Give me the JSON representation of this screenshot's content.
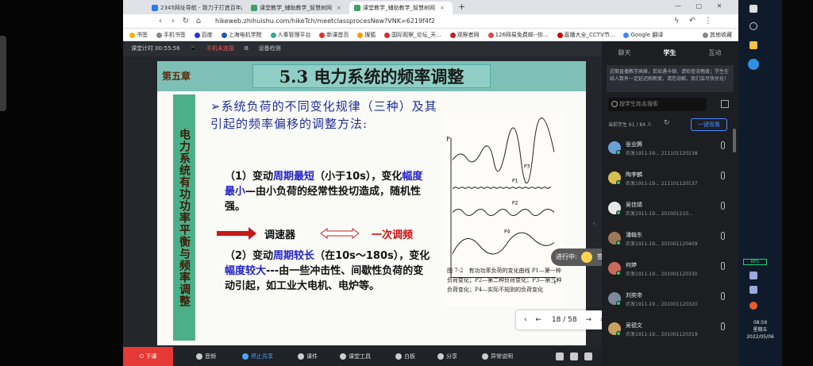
{
  "browser": {
    "tabs": [
      {
        "label": "2345网址导航 - 致力于打造百年品牌",
        "active": false
      },
      {
        "label": "课堂教学_辅助教学_智慧树网",
        "active": false
      },
      {
        "label": "课堂教学_辅助教学_智慧树网",
        "active": true
      }
    ],
    "new_tab": "+",
    "url": "hikeweb.zhihuishu.com/hikeTch/meetclassprocesNew?VNK=6219f4f2",
    "bookmarks": [
      "书签",
      "手机书签",
      "百度",
      "上海电机学院",
      "人事管理平台",
      "新课首页",
      "搜狐",
      "国际观察_论坛_天...",
      "观察者网",
      "126网易免费邮--你...",
      "直播大全_CCTV节...",
      "Google 翻译"
    ],
    "other_bookmarks": "其他收藏"
  },
  "status": {
    "timer": "课堂计时 00:55:56",
    "mobile_connect": "手机未连接",
    "device_check": "设备检测"
  },
  "slide": {
    "chapter": "第五章",
    "title": "5.3 电力系统的频率调整",
    "vertical_title": "电力系统有功功率平衡与频率调整",
    "bullet": "➢系统负荷的不同变化规律（三种）及其引起的频率偏移的调整方法:",
    "p1_prefix": "（1）变动",
    "p1_kw1": "周期最短",
    "p1_mid": "（小于10s），变化",
    "p1_kw2": "幅度最小",
    "p1_suffix": "—由小负荷的经常性投切造成，随机性强。",
    "regulator": "调速器",
    "primary": "一次调频",
    "p2_prefix": "（2）变动",
    "p2_kw1": "周期较长",
    "p2_mid": "（在10s～180s），变化",
    "p2_kw2": "幅度较大",
    "p2_suffix": "---由一些冲击性、间歇性负荷的变动引起，如工业大电机、电炉等。",
    "fig_labels": {
      "p": "P",
      "p3": "P3",
      "p1": "P1",
      "p2": "P2",
      "p4": "P4",
      "t": "t"
    },
    "caption": "图 7-2　有功功率负荷的变化曲线 P1—第一种负荷变化；P2—第二种负荷变化；P3—第三种负荷变化；P4—实际不规则的负荷变化"
  },
  "progress": {
    "label": "进行中:",
    "name": "签到"
  },
  "pager": {
    "prev": "‹",
    "back": "←",
    "current": "18 / 58",
    "fwd": "→",
    "next": "›"
  },
  "bottom": {
    "leave": "下课",
    "audio": "音频",
    "stop_share": "停止共享",
    "courseware": "课件",
    "tools": "课堂工具",
    "whiteboard": "白板",
    "share": "分享",
    "feedback": "异常说明"
  },
  "panel": {
    "tabs": [
      "聊天",
      "学生",
      "互动"
    ],
    "active_tab": "学生",
    "notice": "近期直播教学高峰，若如遇卡顿、请检查流畅度；学生在线人数有一定延迟刷新度，请您谅解。我们会尽快优化！",
    "search_placeholder": "按学生姓名搜索",
    "count": "当前学生 61 / 84 人",
    "summary_btn": "一键观看",
    "students": [
      {
        "name": "张业腾",
        "info": "农发1911-19...  211101120138",
        "avatar": "#6aa0d8"
      },
      {
        "name": "陶李麟",
        "info": "农发1911-19...  211101120137",
        "avatar": "#d8c050"
      },
      {
        "name": "吴佳婧",
        "info": "农发1911-19...  201001210...",
        "avatar": "#e8e8e8"
      },
      {
        "name": "潘翰东",
        "info": "农发1911-19...  201001120409",
        "avatar": "#9a7a5a"
      },
      {
        "name": "何婷",
        "info": "农发1911-19...  201001120330",
        "avatar": "#c86a5a"
      },
      {
        "name": "刘奕帝",
        "info": "农发1911-19...  201001120320",
        "avatar": "#7a8a9a"
      },
      {
        "name": "吴德文",
        "info": "农发1911-19...  201001120319",
        "avatar": "#c8a060"
      }
    ]
  },
  "system": {
    "battery": "88%",
    "time": "08:59",
    "weekday": "星期五",
    "date": "2022/05/06"
  }
}
